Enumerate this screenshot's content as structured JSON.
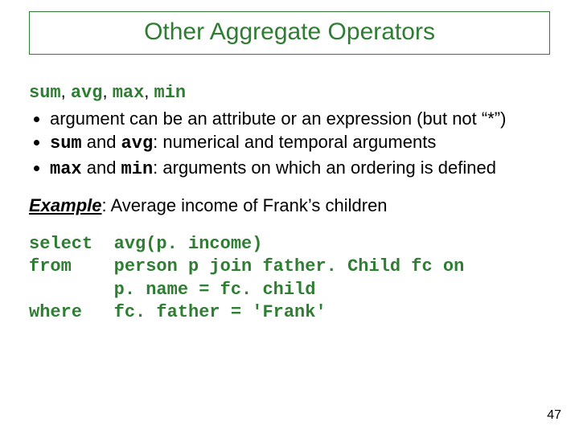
{
  "title": "Other Aggregate Operators",
  "ops_line": {
    "op1": "sum",
    "op2": "avg",
    "op3": "max",
    "op4": "min",
    "sep": ", "
  },
  "bullets": {
    "b1": "argument can be an attribute or an expression (but not “*”)",
    "b2_pre": "sum",
    "b2_mid": " and ",
    "b2_op": "avg",
    "b2_post": ": numerical and temporal arguments",
    "b3_pre": "max",
    "b3_mid": " and ",
    "b3_op": "min",
    "b3_post": ": arguments on which an ordering is defined"
  },
  "example": {
    "label": "Example",
    "text": ": Average income of Frank’s children"
  },
  "sql": {
    "l1": "select  avg(p. income)",
    "l2": "from    person p join father. Child fc on",
    "l3": "        p. name = fc. child",
    "l4": "where   fc. father = 'Frank'"
  },
  "page_number": "47"
}
